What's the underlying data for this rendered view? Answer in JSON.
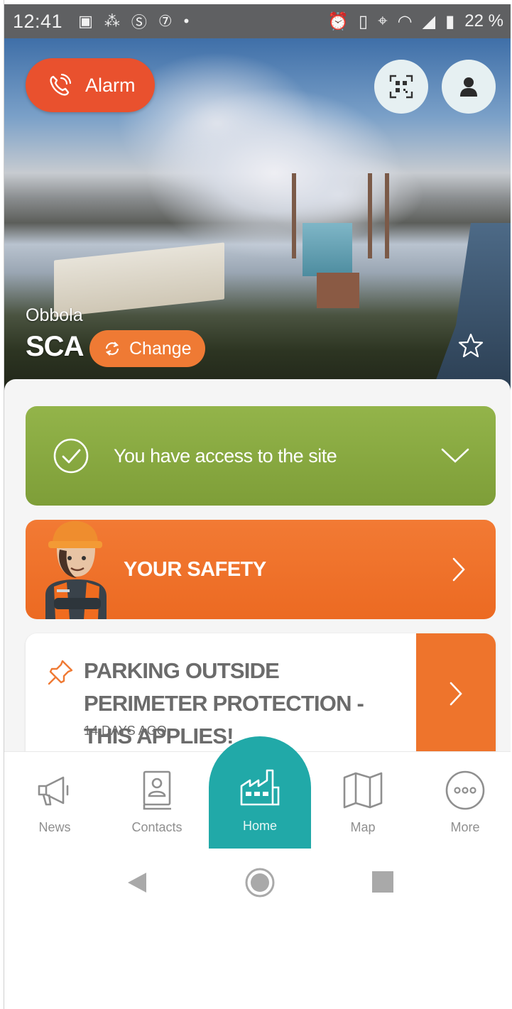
{
  "status_bar": {
    "time": "12:41",
    "left_icons": [
      "news-icon",
      "grid-icon",
      "s-icon",
      "7"
    ],
    "dot": "•",
    "battery": "22 %"
  },
  "hero": {
    "alarm_label": "Alarm",
    "site_name": "Obbola",
    "company": "SCA",
    "change_label": "Change"
  },
  "access": {
    "label": "You have access to the site"
  },
  "safety": {
    "label": "YOUR SAFETY"
  },
  "news": {
    "title": "PARKING OUTSIDE PERIMETER PROTECTION - THIS APPLIES!",
    "date": "14 DAYS AGO"
  },
  "tabs": [
    {
      "label": "News",
      "icon": "megaphone-icon"
    },
    {
      "label": "Contacts",
      "icon": "contact-book-icon"
    },
    {
      "label": "Home",
      "icon": "factory-icon"
    },
    {
      "label": "Map",
      "icon": "map-icon"
    },
    {
      "label": "More",
      "icon": "more-icon"
    }
  ],
  "colors": {
    "alarm": "#e9512e",
    "access_green": "#8aab40",
    "safety_orange": "#ef7130",
    "home_teal": "#21a9a8"
  }
}
